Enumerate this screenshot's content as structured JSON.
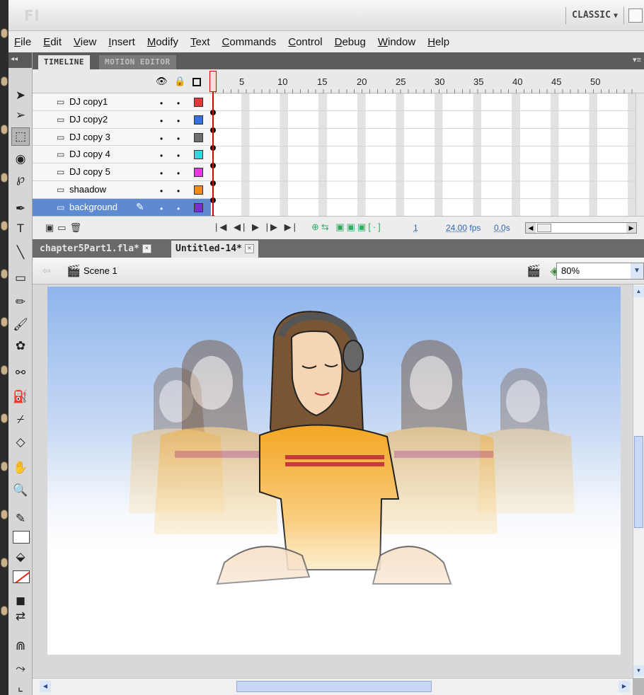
{
  "app": {
    "logo": "Fl",
    "workspace": "CLASSIC"
  },
  "menu": [
    "File",
    "Edit",
    "View",
    "Insert",
    "Modify",
    "Text",
    "Commands",
    "Control",
    "Debug",
    "Window",
    "Help"
  ],
  "timeline": {
    "tabs": [
      "TIMELINE",
      "MOTION EDITOR"
    ],
    "ruler": [
      "5",
      "10",
      "15",
      "20",
      "25",
      "30",
      "35",
      "40",
      "45",
      "50"
    ],
    "layers": [
      {
        "name": "DJ copy1",
        "color": "#e23a3a"
      },
      {
        "name": "DJ copy2",
        "color": "#3a6fe2"
      },
      {
        "name": "DJ copy 3",
        "color": "#6e6e6e"
      },
      {
        "name": "DJ copy 4",
        "color": "#2fd8dc"
      },
      {
        "name": "DJ copy 5",
        "color": "#e23adf"
      },
      {
        "name": "shaadow",
        "color": "#f08a1a"
      },
      {
        "name": "background",
        "color": "#7a2fc8",
        "selected": true
      }
    ],
    "visible_dot": "•",
    "current_frame": "1",
    "fps_value": "24.00",
    "fps_unit": "fps",
    "seconds_value": "0.0",
    "seconds_unit": "s"
  },
  "documents": {
    "tabs": [
      "chapter5Part1.fla*",
      "Untitled-14*"
    ],
    "close": "✕"
  },
  "editbar": {
    "scene": "Scene 1",
    "zoom": "80%"
  },
  "colors": {
    "selection": "#5e8ad1",
    "playhead": "#d00000",
    "stage_top": "#8fb5ec",
    "shirt": "#f5a623"
  }
}
